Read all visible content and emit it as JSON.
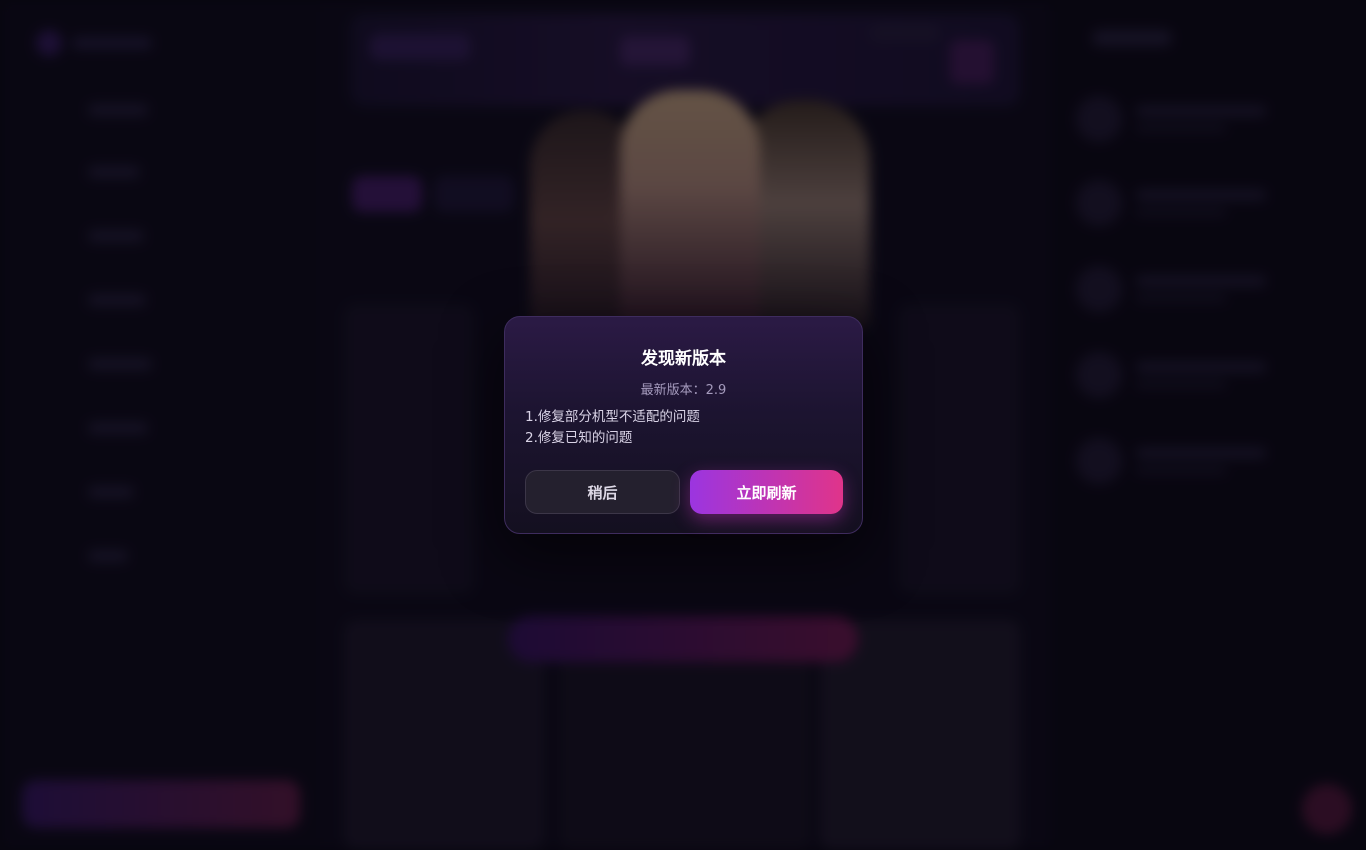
{
  "dialog": {
    "title": "发现新版本",
    "version_label": "最新版本：2.9",
    "notes": [
      "1.修复部分机型不适配的问题",
      "2.修复已知的问题"
    ],
    "later_button": "稍后",
    "refresh_button": "立即刷新"
  },
  "colors": {
    "accent_start": "#9b35e0",
    "accent_end": "#e0348a",
    "dialog_bg": "#1c1430"
  }
}
